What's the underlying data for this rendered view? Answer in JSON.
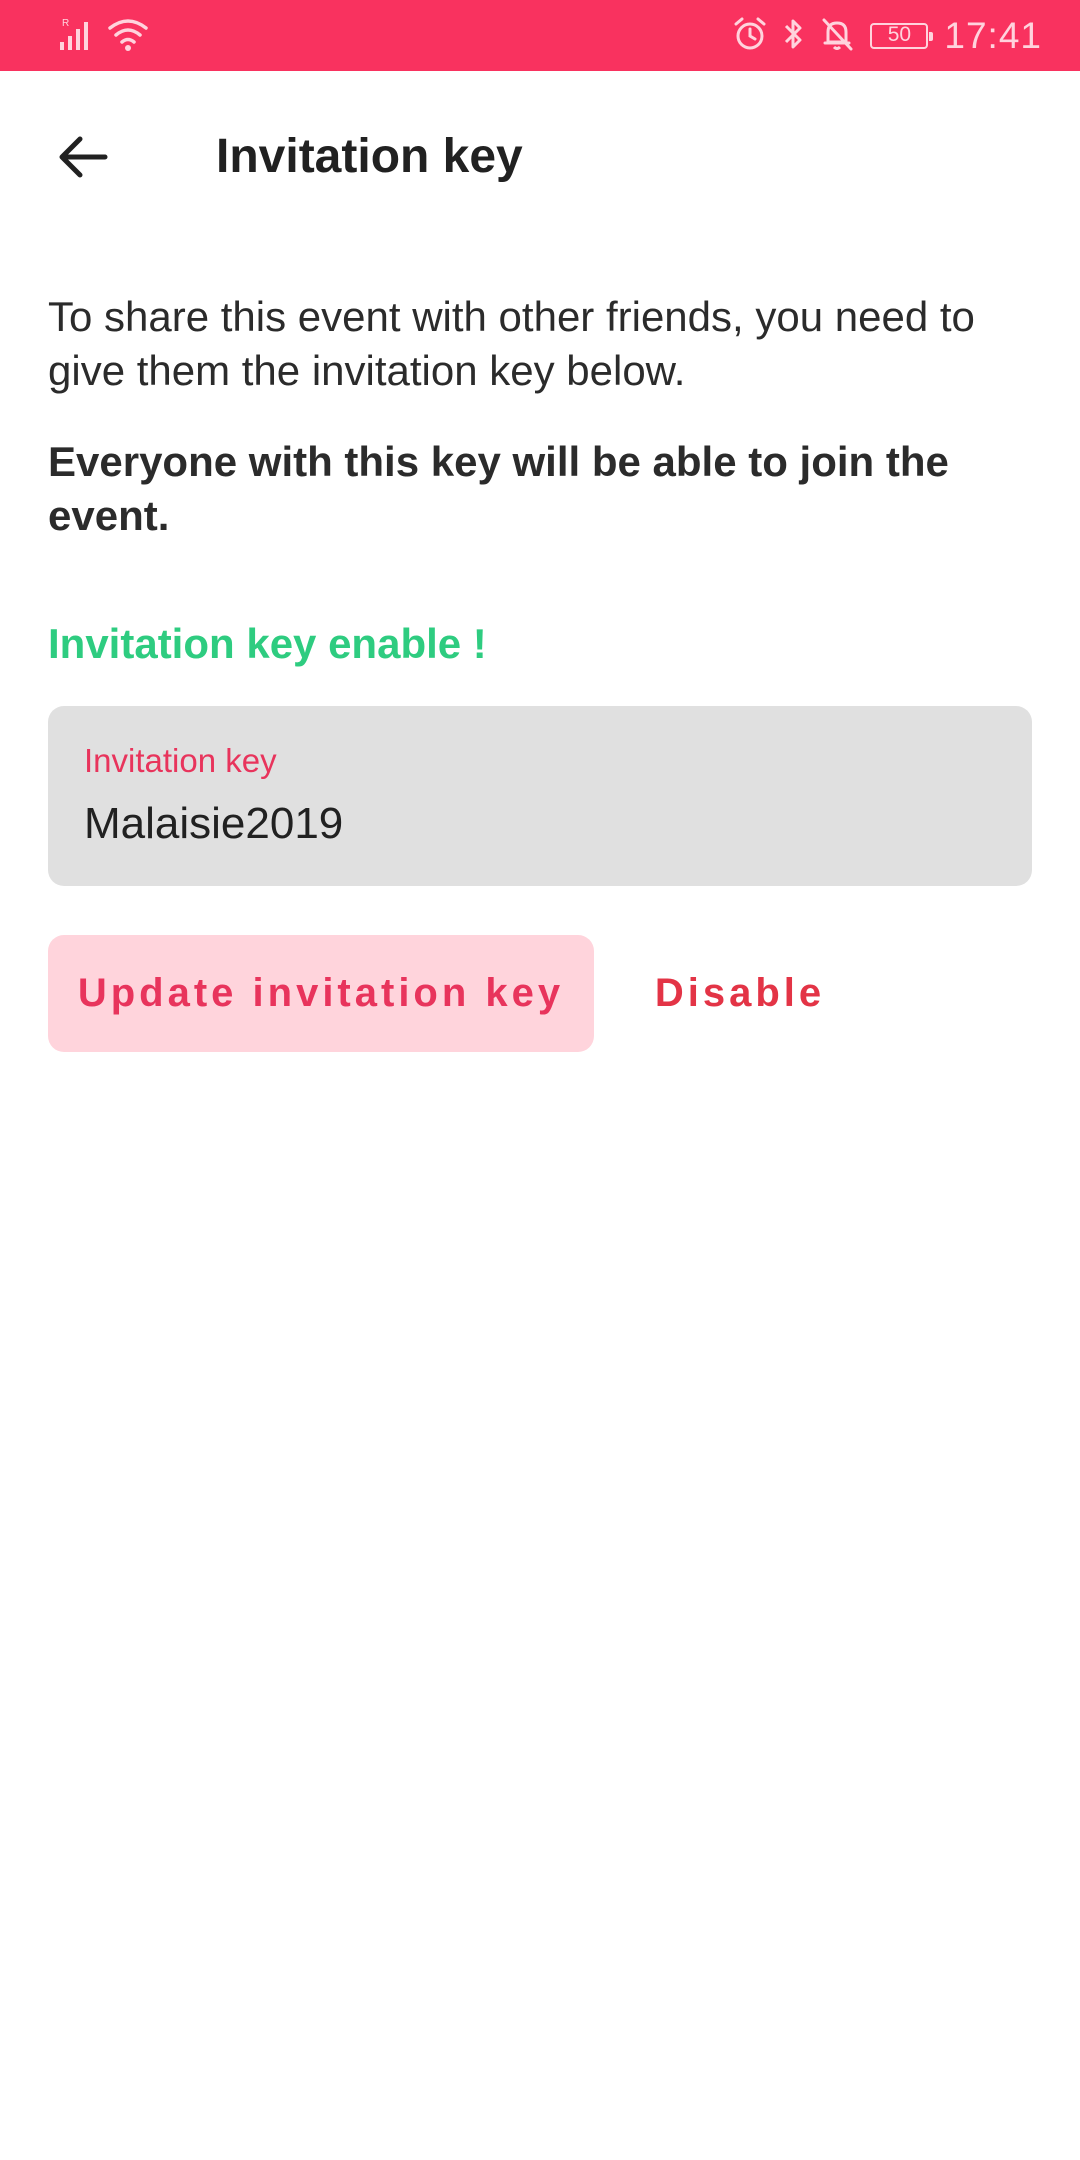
{
  "status_bar": {
    "time": "17:41",
    "battery": "50",
    "signal_label": "R",
    "icons": [
      "signal-icon",
      "wifi-icon",
      "alarm-icon",
      "bluetooth-icon",
      "notifications-off-icon",
      "battery-icon"
    ]
  },
  "app_bar": {
    "back_icon": "arrow-back-icon",
    "title": "Invitation key"
  },
  "content": {
    "description": "To share this event with other friends, you need to give them the invitation key below.",
    "warning": "Everyone with this key will be able to join the event.",
    "status_message": "Invitation key enable !"
  },
  "invitation_field": {
    "label": "Invitation key",
    "value": "Malaisie2019"
  },
  "actions": {
    "update_label": "Update invitation key",
    "disable_label": "Disable"
  },
  "colors": {
    "status_bar": "#f9325f",
    "accent": "#e8345c",
    "success": "#2ecc80",
    "button_tint": "#ffd4dc",
    "field_background": "#e0e0e0"
  }
}
